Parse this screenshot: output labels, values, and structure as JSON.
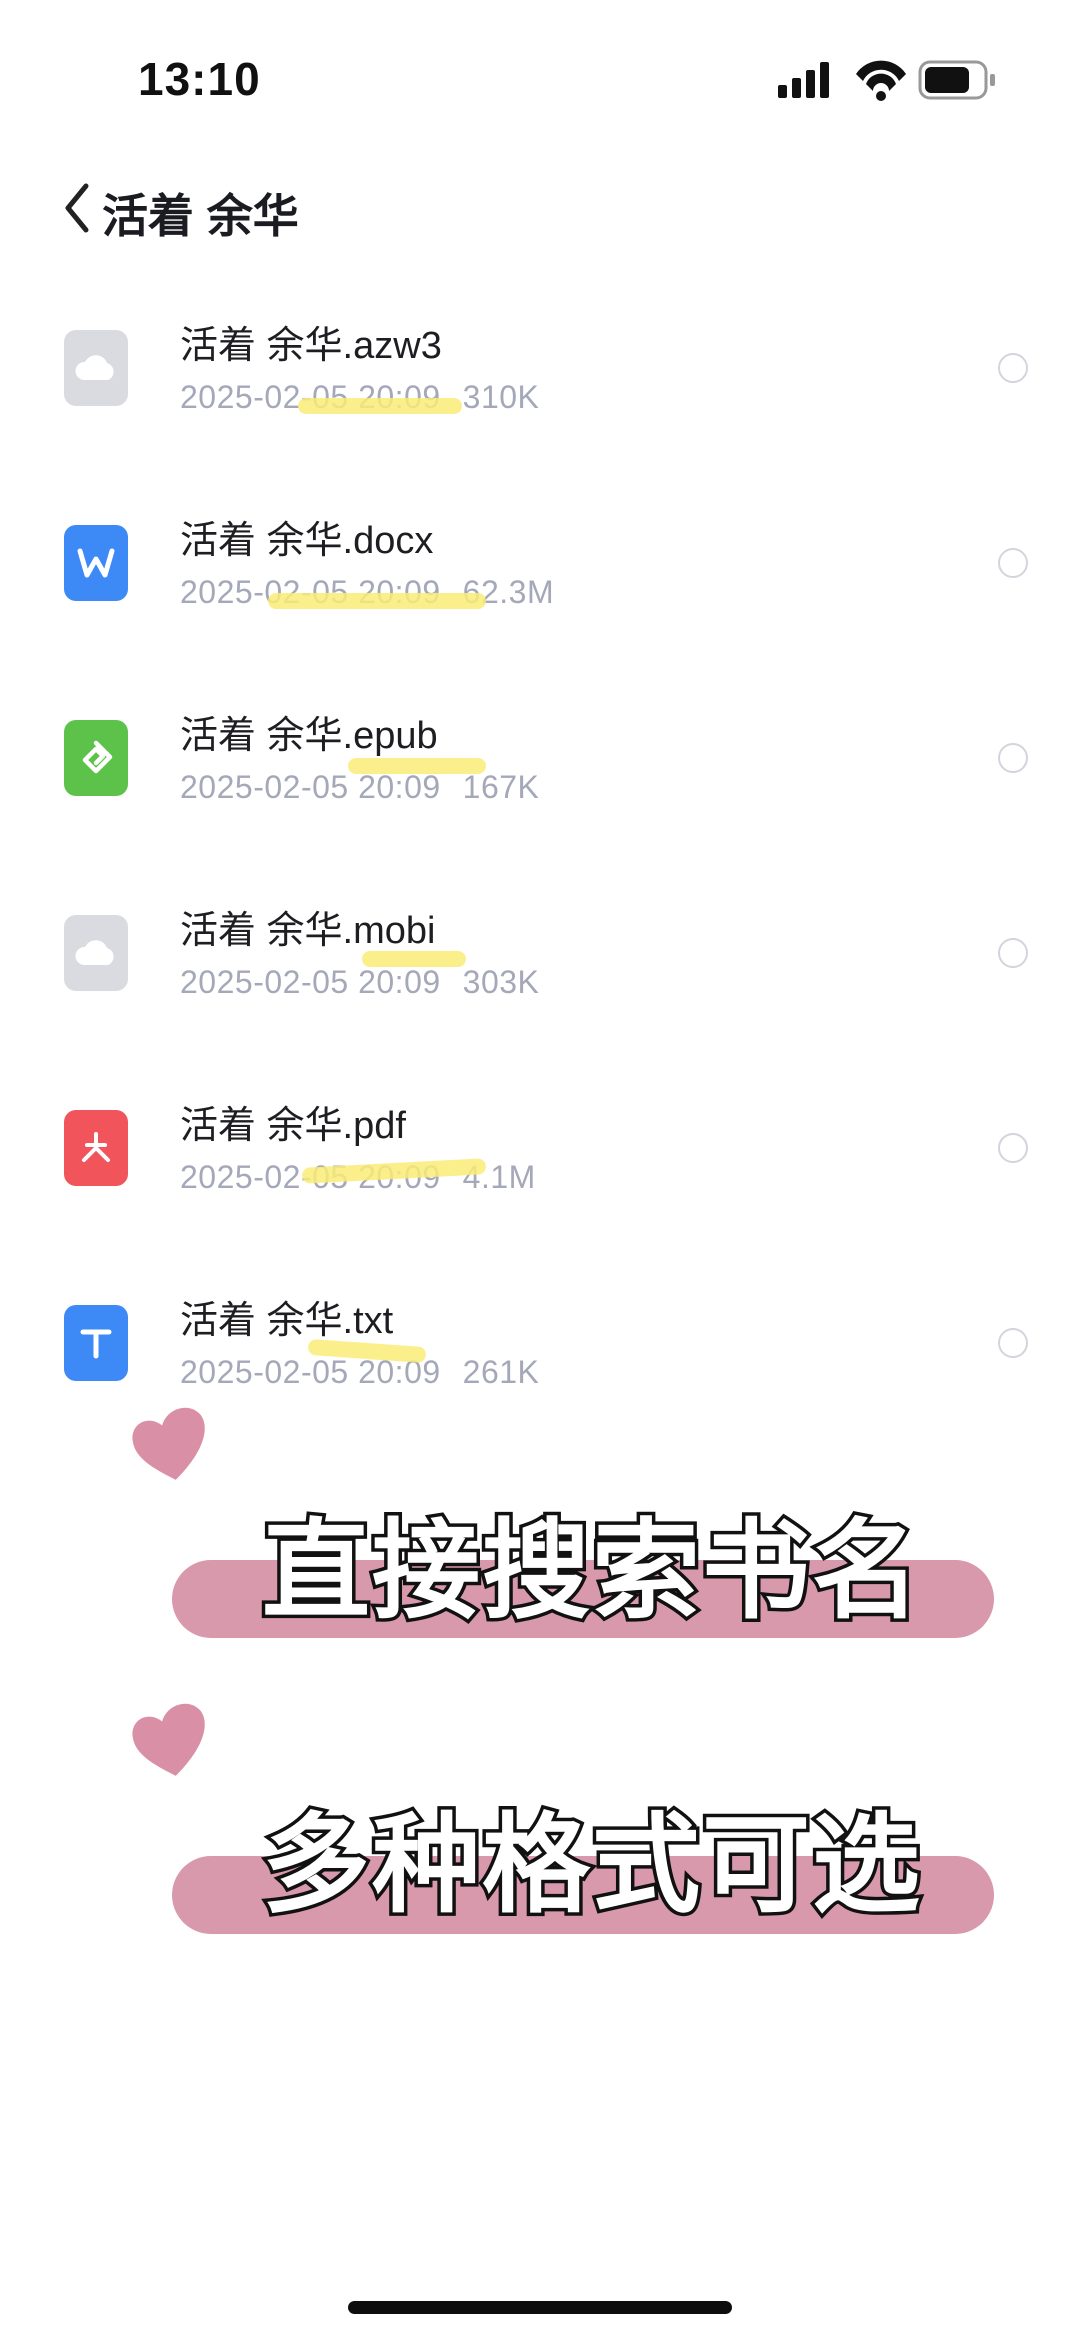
{
  "status_bar": {
    "time": "13:10",
    "icons": [
      "signal-icon",
      "wifi-icon",
      "battery-icon"
    ]
  },
  "header": {
    "title": "活着 余华",
    "back_icon": "chevron-left-icon"
  },
  "files": [
    {
      "name": "活着 余华.azw3",
      "date": "2025-02-05 20:09",
      "size": "310K",
      "icon": "cloud-file-icon",
      "color": "#d9dbe0"
    },
    {
      "name": "活着 余华.docx",
      "date": "2025-02-05 20:09",
      "size": "62.3M",
      "icon": "word-doc-icon",
      "color": "#3d8af7"
    },
    {
      "name": "活着 余华.epub",
      "date": "2025-02-05 20:09",
      "size": "167K",
      "icon": "epub-icon",
      "color": "#5cc24a"
    },
    {
      "name": "活着 余华.mobi",
      "date": "2025-02-05 20:09",
      "size": "303K",
      "icon": "cloud-file-icon",
      "color": "#d9dbe0"
    },
    {
      "name": "活着 余华.pdf",
      "date": "2025-02-05 20:09",
      "size": "4.1M",
      "icon": "pdf-icon",
      "color": "#f2545b"
    },
    {
      "name": "活着 余华.txt",
      "date": "2025-02-05 20:09",
      "size": "261K",
      "icon": "text-file-icon",
      "color": "#3d8af7"
    }
  ],
  "captions": [
    {
      "text": "直接搜索书名"
    },
    {
      "text": "多种格式可选"
    }
  ],
  "colors": {
    "caption_bar": "#d999ac",
    "heart": "#d98fa5",
    "highlight": "#faec78",
    "meta_text": "#a4a8b8"
  }
}
